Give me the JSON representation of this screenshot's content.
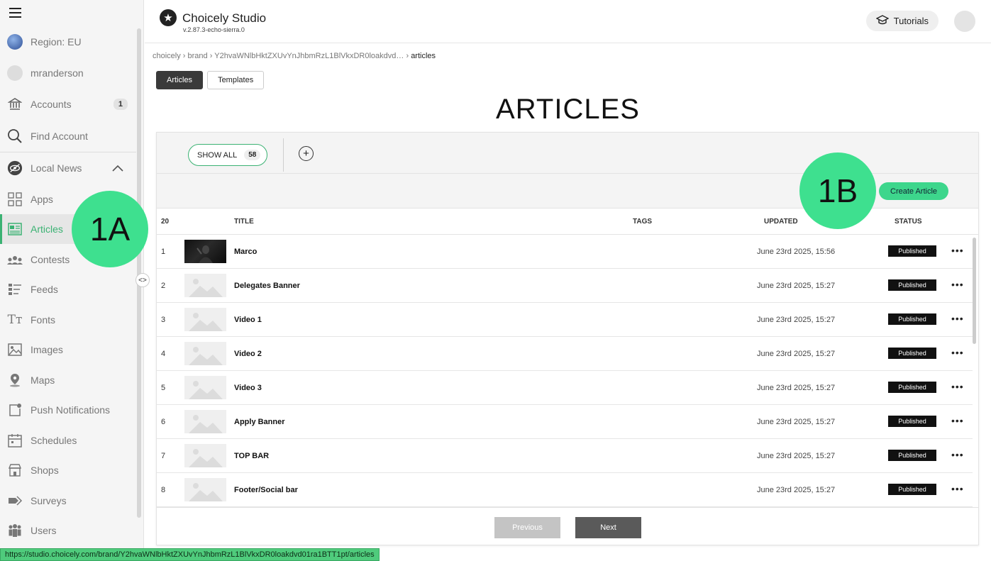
{
  "sidebar": {
    "region": "Region: EU",
    "user": "mranderson",
    "accounts": {
      "label": "Accounts",
      "badge": "1"
    },
    "find_account": "Find Account",
    "section": "Local News",
    "items": [
      {
        "label": "Apps",
        "icon": "grid-icon"
      },
      {
        "label": "Articles",
        "icon": "article-icon"
      },
      {
        "label": "Contests",
        "icon": "contest-icon"
      },
      {
        "label": "Feeds",
        "icon": "feed-icon"
      },
      {
        "label": "Fonts",
        "icon": "font-icon"
      },
      {
        "label": "Images",
        "icon": "image-icon"
      },
      {
        "label": "Maps",
        "icon": "map-pin-icon"
      },
      {
        "label": "Push Notifications",
        "icon": "push-icon"
      },
      {
        "label": "Schedules",
        "icon": "calendar-icon"
      },
      {
        "label": "Shops",
        "icon": "shop-icon"
      },
      {
        "label": "Surveys",
        "icon": "survey-icon"
      },
      {
        "label": "Users",
        "icon": "users-icon"
      }
    ],
    "collapse_glyph": "<>"
  },
  "header": {
    "app_name": "Choicely Studio",
    "version": "v.2.87.3-echo-sierra.0",
    "tutorials": "Tutorials"
  },
  "breadcrumb": {
    "parts": [
      "choicely",
      "brand",
      "Y2hvaWNlbHktZXUvYnJhbmRzL1BlVkxDR0loakdvd…"
    ],
    "current": "articles"
  },
  "tabs": {
    "articles": "Articles",
    "templates": "Templates"
  },
  "page_title": "ARTICLES",
  "filters": {
    "show_all": "SHOW ALL",
    "count": "58"
  },
  "create_button": "Create Article",
  "table": {
    "headers": {
      "count": "20",
      "title": "TITLE",
      "tags": "TAGS",
      "updated": "UPDATED",
      "status": "STATUS"
    },
    "rows": [
      {
        "num": "1",
        "title": "Marco",
        "updated": "June 23rd 2025, 15:56",
        "status": "Published"
      },
      {
        "num": "2",
        "title": "Delegates Banner",
        "updated": "June 23rd 2025, 15:27",
        "status": "Published"
      },
      {
        "num": "3",
        "title": "Video 1",
        "updated": "June 23rd 2025, 15:27",
        "status": "Published"
      },
      {
        "num": "4",
        "title": "Video 2",
        "updated": "June 23rd 2025, 15:27",
        "status": "Published"
      },
      {
        "num": "5",
        "title": "Video 3",
        "updated": "June 23rd 2025, 15:27",
        "status": "Published"
      },
      {
        "num": "6",
        "title": "Apply Banner",
        "updated": "June 23rd 2025, 15:27",
        "status": "Published"
      },
      {
        "num": "7",
        "title": "TOP BAR",
        "updated": "June 23rd 2025, 15:27",
        "status": "Published"
      },
      {
        "num": "8",
        "title": "Footer/Social bar",
        "updated": "June 23rd 2025, 15:27",
        "status": "Published"
      }
    ],
    "more_glyph": "•••"
  },
  "pager": {
    "previous": "Previous",
    "next": "Next"
  },
  "callouts": {
    "a": "1A",
    "b": "1B"
  },
  "status_url": "https://studio.choicely.com/brand/Y2hvaWNlbHktZXUvYnJhbmRzL1BlVkxDR0loakdvd01ra1BTT1pt/articles",
  "colors": {
    "accent": "#3bb273",
    "callout": "#3ee08f",
    "create": "#3dd68c"
  }
}
